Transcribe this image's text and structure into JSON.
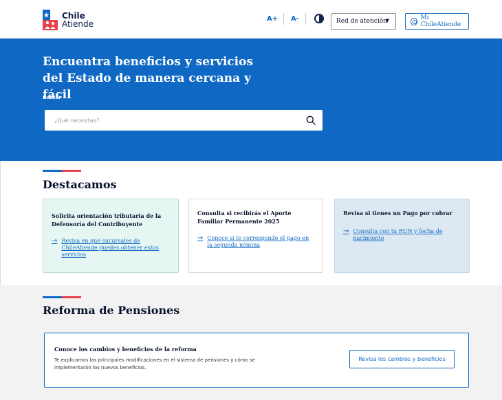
{
  "header": {
    "logo": {
      "line1": "Chile",
      "line2": "Atiende"
    },
    "font_increase": "A+",
    "font_decrease": "A-",
    "contrast_icon": "contrast-icon",
    "red_atencion_label": "Red de atención",
    "mi_chileatiende_label": "Mi ChileAtiende"
  },
  "hero": {
    "title": "Encuentra beneficios y servicios del Estado de manera cercana y fácil",
    "search_label": "Buscar",
    "search_placeholder": "¿Qué necesitas?",
    "search_icon": "search-icon"
  },
  "destacamos": {
    "title": "Destacamos",
    "cards": [
      {
        "title": "Solicita orientación tributaria de la Defensoría del Contribuyente",
        "link": "Revisa en qué sucursales de ChileAtiende puedes obtener estos servicios",
        "bg": "#e6f7f3",
        "border": "#b5dfd3"
      },
      {
        "title": "Consulta si recibirás el Aporte Familiar Permanente 2025",
        "link": "Conoce si te corresponde el pago en la segunda nómina",
        "bg": "#ffffff",
        "border": "#d9d9d9"
      },
      {
        "title": "Revisa si tienes un Pago por cobrar",
        "link": "Consulta con tu RUN y fecha de nacimiento",
        "bg": "#dce9f2",
        "border": "#c3d7e5"
      }
    ]
  },
  "reforma": {
    "title": "Reforma de Pensiones",
    "card_title": "Conoce los cambios y beneficios de la reforma",
    "card_text": "Te explicamos las principales modificaciones en el sistema de pensiones y cómo se implementarán los nuevos beneficios.",
    "button": "Revisa los cambios y beneficios"
  },
  "colors": {
    "primary": "#0f69c4",
    "accent_red": "#e5404b",
    "navy": "#0f1e4a"
  }
}
